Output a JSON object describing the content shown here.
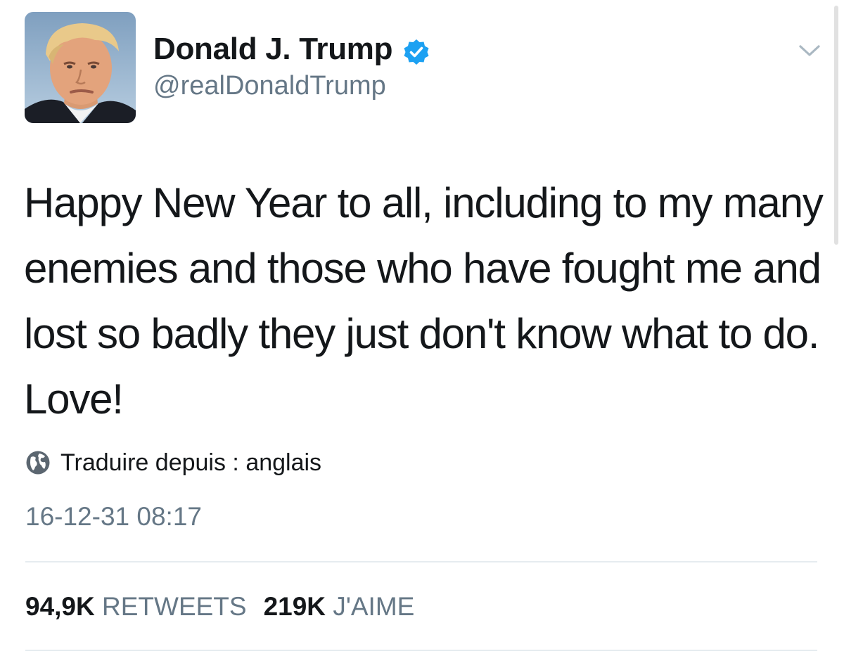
{
  "author": {
    "display_name": "Donald J. Trump",
    "handle": "@realDonaldTrump",
    "verified": true,
    "verified_color": "#1da1f2"
  },
  "tweet": {
    "text": "Happy New Year to all, including to my many enemies and those who have fought me and lost so badly they just don't know what to do. Love!",
    "translate_label": "Traduire depuis : anglais",
    "timestamp": "16-12-31 08:17"
  },
  "stats": {
    "retweets_count": "94,9K",
    "retweets_label": "RETWEETS",
    "likes_count": "219K",
    "likes_label": "J'AIME"
  },
  "icons": {
    "menu": "chevron-down-icon",
    "translate": "globe-icon",
    "verified": "verified-badge-icon"
  },
  "colors": {
    "text_primary": "#14171a",
    "text_secondary": "#657786",
    "divider": "#e6ecf0"
  }
}
